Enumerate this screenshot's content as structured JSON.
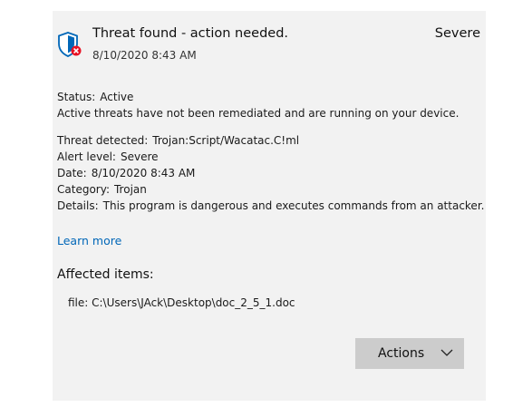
{
  "header": {
    "title": "Threat found - action needed.",
    "date": "8/10/2020 8:43 AM",
    "severity": "Severe",
    "icon": "shield-error-icon"
  },
  "status": {
    "label": "Status:",
    "value": "Active",
    "description": "Active threats have not been remediated and are running on your device."
  },
  "details": [
    {
      "label": "Threat detected:",
      "value": "Trojan:Script/Wacatac.C!ml"
    },
    {
      "label": "Alert level:",
      "value": "Severe"
    },
    {
      "label": "Date:",
      "value": "8/10/2020 8:43 AM"
    },
    {
      "label": "Category:",
      "value": "Trojan"
    },
    {
      "label": "Details:",
      "value": "This program is dangerous and executes commands from an attacker."
    }
  ],
  "learn_more": "Learn more",
  "affected": {
    "title": "Affected items:",
    "items": [
      "file: C:\\Users\\JAck\\Desktop\\doc_2_5_1.doc"
    ]
  },
  "actions_button": {
    "label": "Actions",
    "icon": "chevron-down-icon"
  },
  "colors": {
    "panel_bg": "#f2f2f2",
    "link": "#0067b8",
    "button_bg": "#cccccc",
    "shield_blue": "#0067b8",
    "badge_red": "#e81123"
  }
}
